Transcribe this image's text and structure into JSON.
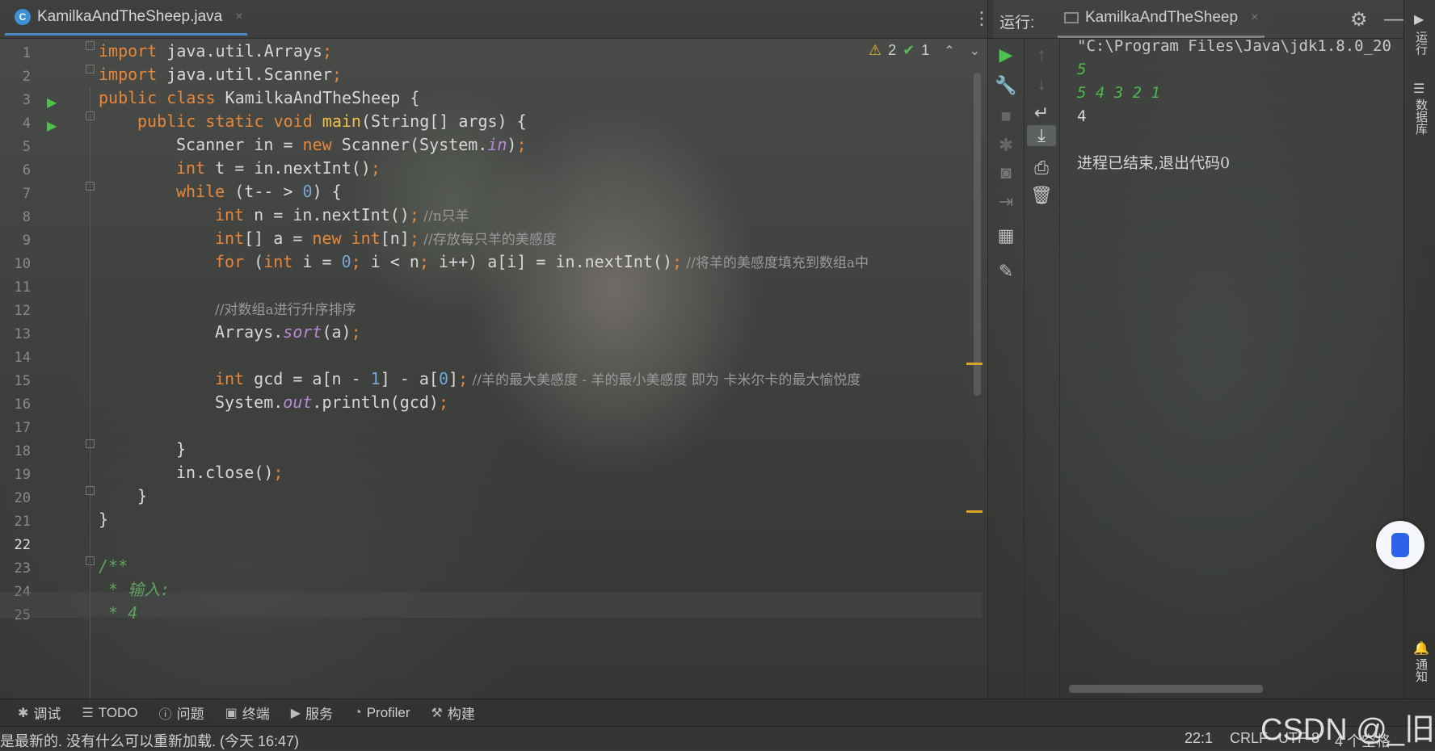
{
  "editor": {
    "tab": {
      "label": "KamilkaAndTheSheep.java",
      "close": "×"
    },
    "menu": "⋮",
    "inspections": {
      "warnings": "2",
      "ok": "1"
    },
    "line_numbers": [
      "1",
      "2",
      "3",
      "4",
      "5",
      "6",
      "7",
      "8",
      "9",
      "10",
      "11",
      "12",
      "13",
      "14",
      "15",
      "16",
      "17",
      "18",
      "19",
      "20",
      "21",
      "22",
      "23",
      "24",
      "25"
    ],
    "current_line": "22",
    "code": {
      "l1": {
        "kw": "import",
        "rest": " java.util.Arrays",
        "semi": ";"
      },
      "l2": {
        "kw": "import",
        "rest": " java.util.Scanner",
        "semi": ";"
      },
      "l3": {
        "kw": "public class",
        "rest": " KamilkaAndTheSheep {"
      },
      "l4": {
        "kw": "public static void",
        "fn": " main",
        "rest": "(String[] args) {"
      },
      "l5": {
        "a": "Scanner in = ",
        "kw": "new",
        "b": " Scanner(System.",
        "st": "in",
        "c": ")",
        "semi": ";"
      },
      "l6": {
        "kw": "int",
        "a": " t = in.nextInt()",
        "semi": ";"
      },
      "l7": {
        "kw": "while",
        "a": " (t-- > ",
        "num": "0",
        "b": ") {"
      },
      "l8": {
        "kw": "int",
        "a": " n = in.nextInt()",
        "semi": ";",
        "cm": " //n只羊"
      },
      "l9": {
        "kw": "int",
        "a": "[] a = ",
        "kw2": "new",
        "kw3": " int",
        "b": "[n]",
        "semi": ";",
        "cm": " //存放每只羊的美感度"
      },
      "l10": {
        "kw": "for",
        "a": " (",
        "kw2": "int",
        "b": " i = ",
        "num": "0",
        "semi1": ";",
        "c": " i < n",
        "semi2": ";",
        "d": " i++) a[i] = in.nextInt()",
        "semi3": ";",
        "cm": " //将羊的美感度填充到数组a中"
      },
      "l12": {
        "cm": "//对数组a进行升序排序"
      },
      "l13": {
        "a": "Arrays.",
        "st": "sort",
        "b": "(a)",
        "semi": ";"
      },
      "l15": {
        "kw": "int",
        "a": " gcd = a[n - ",
        "num": "1",
        "b": "] - a[",
        "num2": "0",
        "c": "]",
        "semi": ";",
        "cm": " //羊的最大美感度 - 羊的最小美感度 即为 卡米尔卡的最大愉悦度"
      },
      "l16": {
        "a": "System.",
        "st": "out",
        "b": ".println(gcd)",
        "semi": ";"
      },
      "l18": {
        "a": "}"
      },
      "l19": {
        "a": "in.close()",
        "semi": ";"
      },
      "l20": {
        "a": "}"
      },
      "l21": {
        "a": "}"
      },
      "l23": {
        "doc": "/**"
      },
      "l24": {
        "doc": " * 输入:"
      },
      "l25": {
        "doc": " * 4"
      }
    }
  },
  "run_panel": {
    "title": "运行:",
    "tab_label": "KamilkaAndTheSheep",
    "tab_close": "×",
    "console": {
      "command": "\"C:\\Program Files\\Java\\jdk1.8.0_20",
      "input1": "5",
      "input2": "5 4 3 2 1",
      "output": "4",
      "exit": "进程已结束,退出代码0"
    }
  },
  "right_stripe": {
    "top_label": "运行",
    "db_label": "数据库",
    "notify_label": "通知"
  },
  "tool_tabs": [
    {
      "icon": "bug-icon",
      "label": "调试"
    },
    {
      "icon": "list-icon",
      "label": "TODO"
    },
    {
      "icon": "info-icon",
      "label": "问题"
    },
    {
      "icon": "terminal-icon",
      "label": "终端"
    },
    {
      "icon": "play-circle-icon",
      "label": "服务"
    },
    {
      "icon": "profiler-icon",
      "label": "Profiler"
    },
    {
      "icon": "hammer-icon",
      "label": "构建"
    }
  ],
  "status_bar": {
    "message": "是最新的. 没有什么可以重新加载. (今天 16:47)",
    "position": "22:1",
    "line_ending": "CRLF",
    "encoding": "UTF-8",
    "indent": "4 个空格"
  },
  "watermark": "CSDN @_旧梧",
  "colors": {
    "keyword": "#e8873a",
    "method": "#f2c04a",
    "number": "#74a7d8",
    "static": "#b98ad8",
    "doc": "#5fa35f",
    "input": "#4fb84f",
    "accent": "#4a88c7"
  }
}
